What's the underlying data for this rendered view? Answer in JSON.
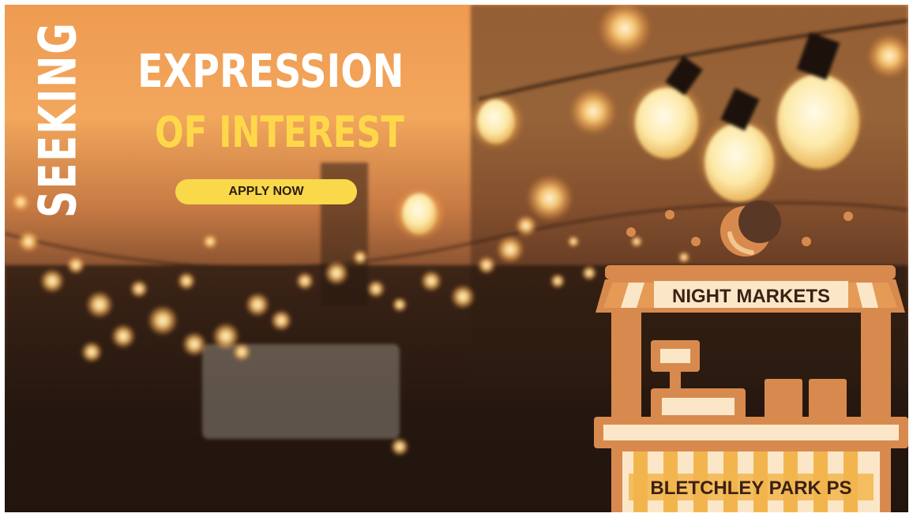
{
  "headline": {
    "vertical": "SEEKING",
    "line1": "EXPRESSION",
    "line2": "OF INTEREST"
  },
  "cta": {
    "label": "APPLY NOW"
  },
  "stall": {
    "sign": "NIGHT MARKETS",
    "counter": "BLETCHLEY PARK PS"
  },
  "colors": {
    "accent_yellow": "#f9d84a",
    "stall_orange": "#d88a4e",
    "stall_cream": "#fbe7c8",
    "text_dark": "#3a2113"
  }
}
